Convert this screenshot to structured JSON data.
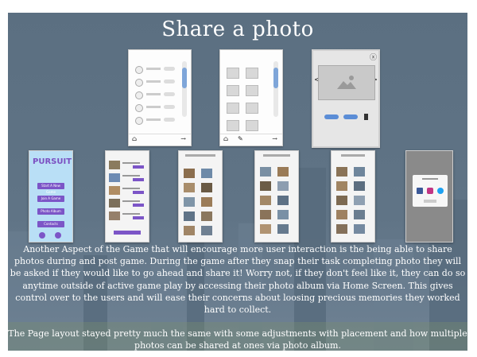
{
  "slide": {
    "title": "Share a photo",
    "paragraph1": "Another Aspect of the Game that will encourage more user interaction is the being able to share photos during and post game.  During the game after they snap their task completing photo they will be asked if they would like to go ahead and share it!  Worry not, if they don't feel like it, they can do so anytime outside of active game play by accessing their photo album via Home Screen.  This gives control over to the users and will ease their concerns about loosing precious memories they worked hard to collect.",
    "paragraph2": "The Page layout stayed pretty much the same with some adjustments with placement and how multiple photos can be shared at ones via photo album."
  },
  "wireframes": {
    "nav_home_icon": "home-icon",
    "nav_edit_icon": "pencil-icon",
    "nav_next_icon": "arrow-right-icon",
    "close_icon": "close-icon",
    "prev_arrow": "<",
    "next_arrow": ">",
    "arrow_glyph": "→",
    "home_glyph": "⌂",
    "pencil_glyph": "✎",
    "close_glyph": "ⓧ"
  },
  "pursuit_screen": {
    "logo": "PURSUIT",
    "buttons": [
      "Start A New Game",
      "Join A Game",
      "Photo Album",
      "Contacts"
    ]
  },
  "colors": {
    "slide_bg": "#5a6e80",
    "accent_purple": "#7c55c7",
    "wireframe_blue": "#5b8dd6",
    "pursuit_bg": "#b9dff6"
  }
}
